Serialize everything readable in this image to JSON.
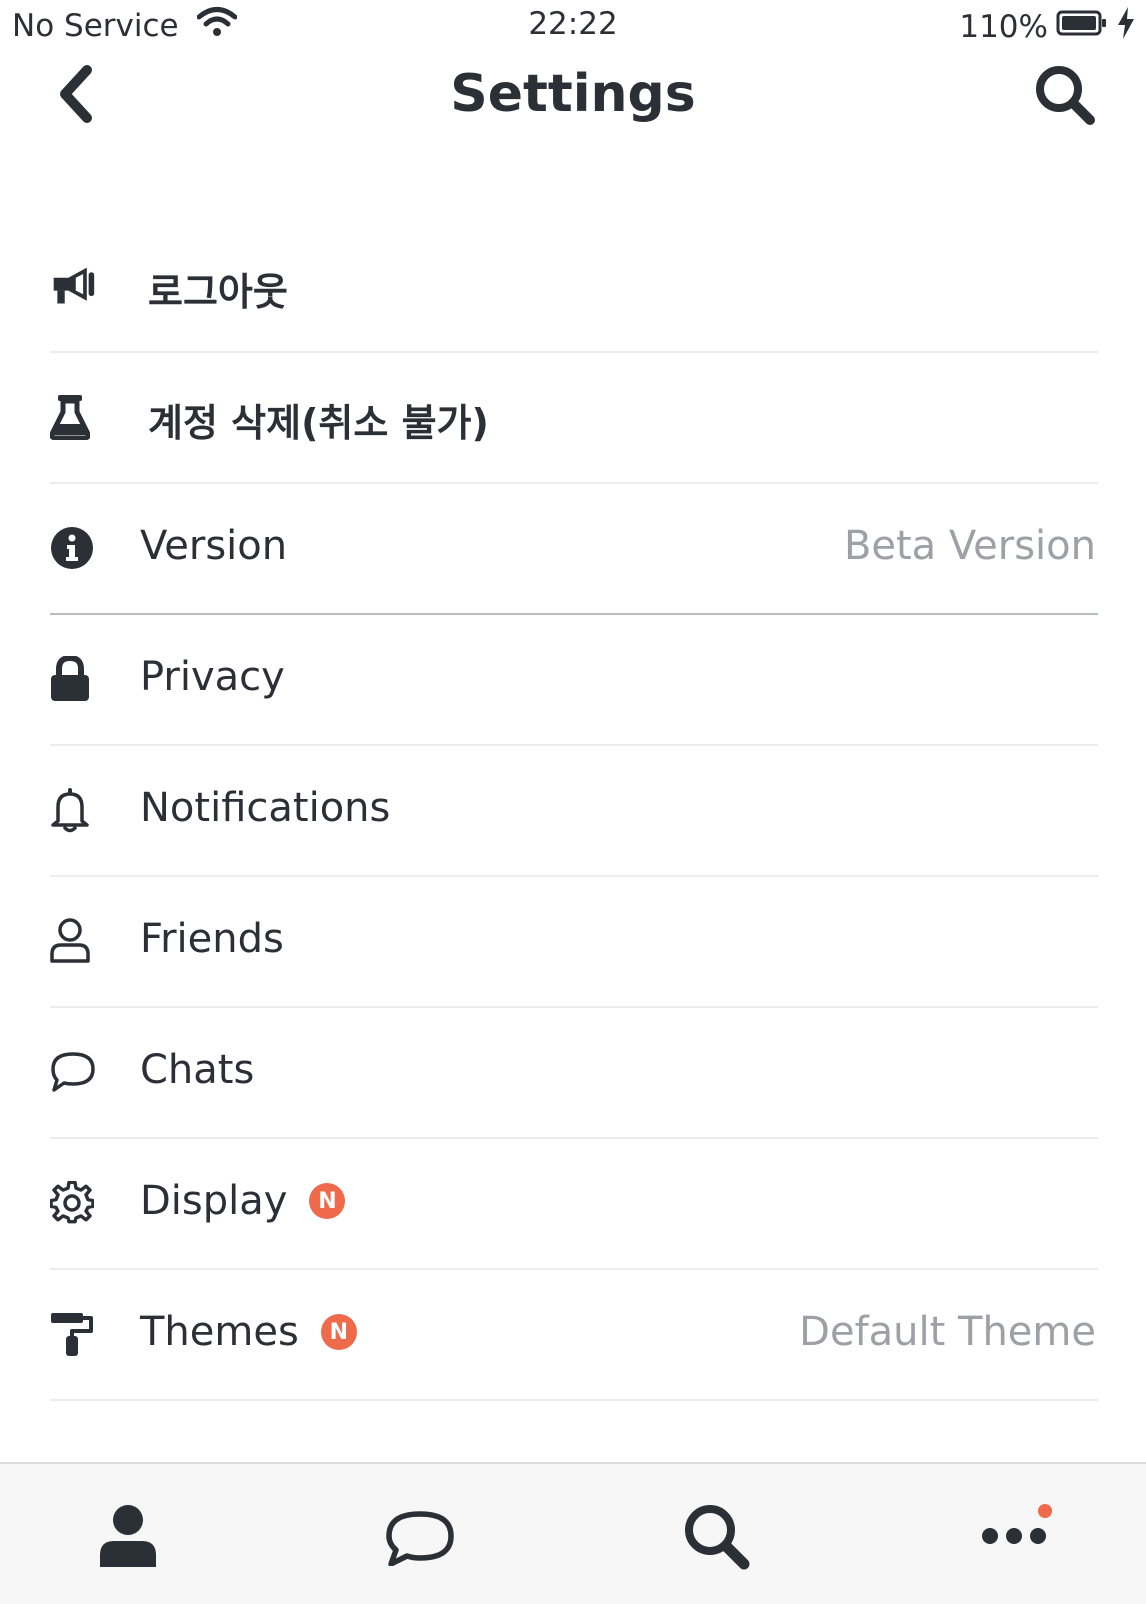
{
  "status_bar": {
    "carrier": "No Service",
    "time": "22:22",
    "battery": "110%"
  },
  "nav": {
    "title": "Settings",
    "back_icon": "chevron-left-icon",
    "search_icon": "search-icon"
  },
  "settings": {
    "items": [
      {
        "label": "로그아웃",
        "icon": "megaphone-icon",
        "value": ""
      },
      {
        "label": "계정 삭제(취소 불가)",
        "icon": "flask-icon",
        "value": ""
      },
      {
        "label": "Version",
        "icon": "info-icon",
        "value": "Beta Version"
      },
      {
        "label": "Privacy",
        "icon": "lock-icon",
        "value": ""
      },
      {
        "label": "Notifications",
        "icon": "bell-icon",
        "value": ""
      },
      {
        "label": "Friends",
        "icon": "user-icon",
        "value": ""
      },
      {
        "label": "Chats",
        "icon": "chat-bubble-icon",
        "value": ""
      },
      {
        "label": "Display",
        "icon": "gear-icon",
        "value": "",
        "badge": "N"
      },
      {
        "label": "Themes",
        "icon": "paint-roller-icon",
        "value": "Default Theme",
        "badge": "N"
      }
    ]
  },
  "tab_bar": {
    "tabs": [
      {
        "name": "friends-tab",
        "icon": "person-icon"
      },
      {
        "name": "chats-tab",
        "icon": "chat-bubble-icon"
      },
      {
        "name": "search-tab",
        "icon": "search-icon"
      },
      {
        "name": "more-tab",
        "icon": "more-dots-icon"
      }
    ]
  },
  "colors": {
    "text": "#2b2f36",
    "muted": "#9da0a5",
    "accent": "#ef6a4a",
    "divider": "#ececec",
    "tab_bar_bg": "#f7f7f8"
  }
}
